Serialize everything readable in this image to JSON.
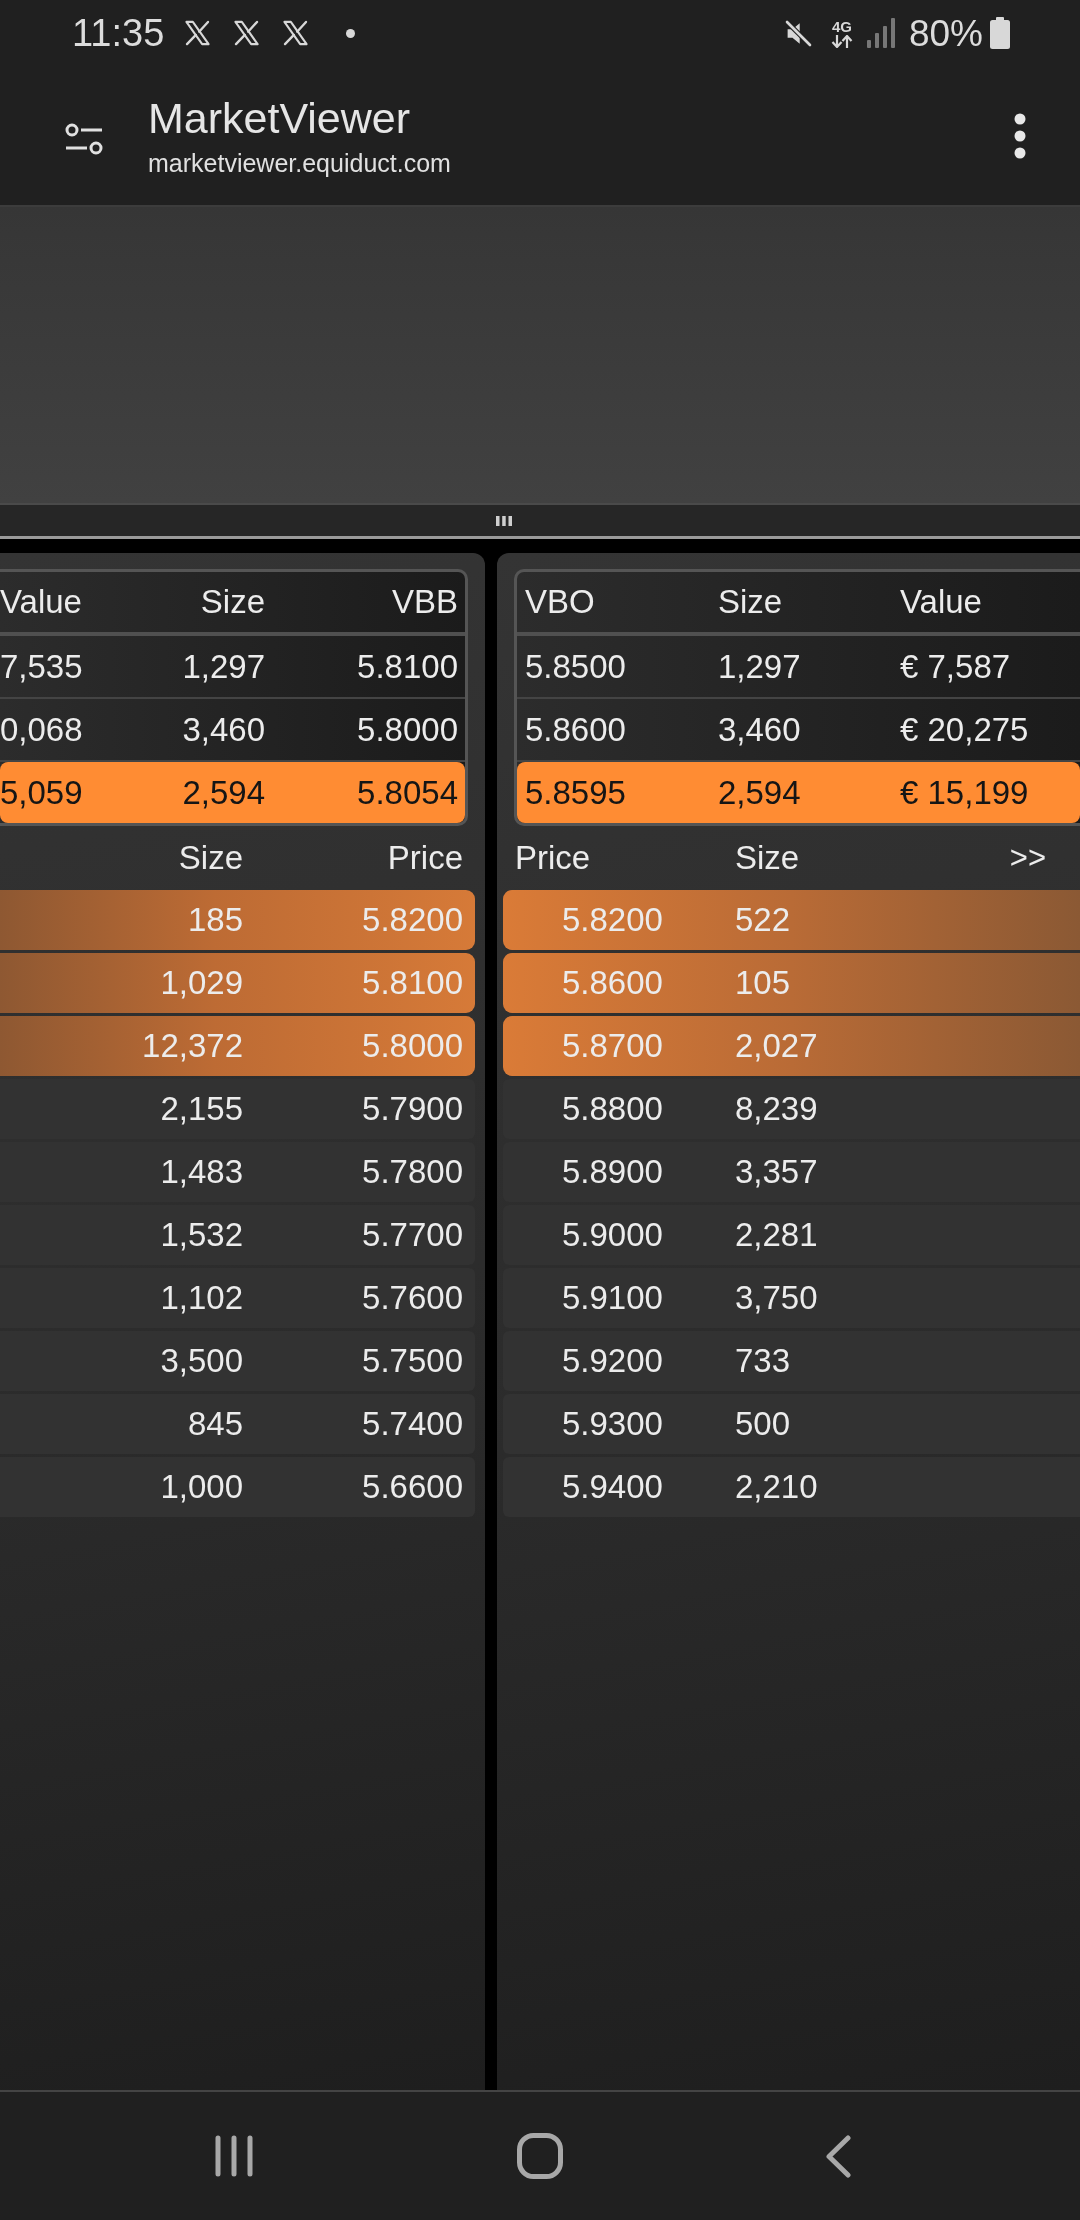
{
  "status_bar": {
    "time": "11:35",
    "network": "4G",
    "battery": "80%"
  },
  "app_bar": {
    "title": "MarketViewer",
    "url": "marketviewer.equiduct.com"
  },
  "bid_panel": {
    "summary": {
      "columns": [
        "Value",
        "Size",
        "VBB"
      ],
      "rows": [
        {
          "cells": [
            "7,535",
            "1,297",
            "5.8100"
          ],
          "highlighted": false
        },
        {
          "cells": [
            "0,068",
            "3,460",
            "5.8000"
          ],
          "highlighted": false
        },
        {
          "cells": [
            "5,059",
            "2,594",
            "5.8054"
          ],
          "highlighted": true
        }
      ]
    },
    "book": {
      "columns": [
        "Size",
        "Price"
      ],
      "rows": [
        {
          "cells": [
            "185",
            "5.8200"
          ],
          "highlighted": true
        },
        {
          "cells": [
            "1,029",
            "5.8100"
          ],
          "highlighted": true
        },
        {
          "cells": [
            "12,372",
            "5.8000"
          ],
          "highlighted": true
        },
        {
          "cells": [
            "2,155",
            "5.7900"
          ],
          "highlighted": false
        },
        {
          "cells": [
            "1,483",
            "5.7800"
          ],
          "highlighted": false
        },
        {
          "cells": [
            "1,532",
            "5.7700"
          ],
          "highlighted": false
        },
        {
          "cells": [
            "1,102",
            "5.7600"
          ],
          "highlighted": false
        },
        {
          "cells": [
            "3,500",
            "5.7500"
          ],
          "highlighted": false
        },
        {
          "cells": [
            "845",
            "5.7400"
          ],
          "highlighted": false
        },
        {
          "cells": [
            "1,000",
            "5.6600"
          ],
          "highlighted": false
        }
      ]
    }
  },
  "ask_panel": {
    "summary": {
      "columns": [
        "VBO",
        "Size",
        "Value"
      ],
      "rows": [
        {
          "cells": [
            "5.8500",
            "1,297",
            "€ 7,587"
          ],
          "highlighted": false
        },
        {
          "cells": [
            "5.8600",
            "3,460",
            "€ 20,275"
          ],
          "highlighted": false
        },
        {
          "cells": [
            "5.8595",
            "2,594",
            "€ 15,199"
          ],
          "highlighted": true
        }
      ]
    },
    "book": {
      "columns": [
        "Price",
        "Size"
      ],
      "more_button": ">>",
      "rows": [
        {
          "cells": [
            "5.8200",
            "522"
          ],
          "highlighted": true
        },
        {
          "cells": [
            "5.8600",
            "105"
          ],
          "highlighted": true
        },
        {
          "cells": [
            "5.8700",
            "2,027"
          ],
          "highlighted": true
        },
        {
          "cells": [
            "5.8800",
            "8,239"
          ],
          "highlighted": false
        },
        {
          "cells": [
            "5.8900",
            "3,357"
          ],
          "highlighted": false
        },
        {
          "cells": [
            "5.9000",
            "2,281"
          ],
          "highlighted": false
        },
        {
          "cells": [
            "5.9100",
            "3,750"
          ],
          "highlighted": false
        },
        {
          "cells": [
            "5.9200",
            "733"
          ],
          "highlighted": false
        },
        {
          "cells": [
            "5.9300",
            "500"
          ],
          "highlighted": false
        },
        {
          "cells": [
            "5.9400",
            "2,210"
          ],
          "highlighted": false
        }
      ]
    }
  }
}
